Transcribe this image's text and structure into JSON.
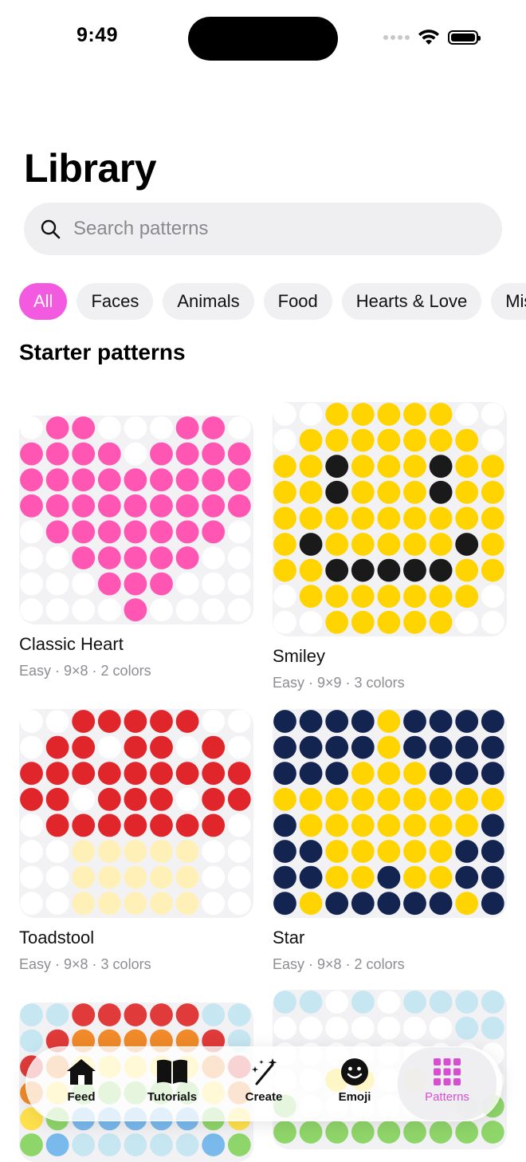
{
  "status": {
    "time": "9:49"
  },
  "page": {
    "title": "Library"
  },
  "search": {
    "placeholder": "Search patterns",
    "value": ""
  },
  "filters": [
    {
      "label": "All",
      "active": true
    },
    {
      "label": "Faces",
      "active": false
    },
    {
      "label": "Animals",
      "active": false
    },
    {
      "label": "Food",
      "active": false
    },
    {
      "label": "Hearts & Love",
      "active": false
    },
    {
      "label": "Misc",
      "active": false
    }
  ],
  "section": {
    "title": "Starter patterns"
  },
  "colors": {
    "accent": "#f25be0",
    "empty_dot": "#ffffff",
    "heart_pink": "#ff56b3",
    "yellow": "#ffd400",
    "black": "#1a1a1a",
    "red": "#e0262b",
    "cream": "#fff0b8",
    "navy": "#142451"
  },
  "patterns": [
    {
      "name": "Classic Heart",
      "meta": "Easy · 9×8 · 2 colors",
      "palette": {
        "0": "#ffffff",
        "1": "#ff56b3"
      },
      "grid": [
        "011000110",
        "111101111",
        "111111111",
        "111111111",
        "011111110",
        "001111100",
        "000111000",
        "000010000"
      ]
    },
    {
      "name": "Smiley",
      "meta": "Easy · 9×9 · 3 colors",
      "palette": {
        "0": "#ffffff",
        "1": "#ffd400",
        "2": "#1a1a1a"
      },
      "grid": [
        "001111100",
        "011111110",
        "112111211",
        "112111211",
        "111111111",
        "121111121",
        "112222211",
        "011111110",
        "001111100"
      ]
    },
    {
      "name": "Toadstool",
      "meta": "Easy · 9×8 · 3 colors",
      "palette": {
        "0": "#ffffff",
        "1": "#e0262b",
        "2": "#fff0b8"
      },
      "grid": [
        "001111100",
        "011011010",
        "111111111",
        "110111011",
        "011111110",
        "002222200",
        "002222200",
        "002222200"
      ]
    },
    {
      "name": "Star",
      "meta": "Easy · 9×8 · 2 colors",
      "palette": {
        "0": "#142451",
        "1": "#ffd400"
      },
      "grid": [
        "000010000",
        "000010000",
        "000111000",
        "111111111",
        "011111110",
        "001111100",
        "001101100",
        "010000010"
      ]
    },
    {
      "name": "",
      "meta": "",
      "palette": {
        "0": "#c6e6f2",
        "1": "#e03a3a",
        "2": "#f08a2a",
        "3": "#ffe14d",
        "4": "#8fd66a",
        "5": "#79b9ec"
      },
      "grid": [
        "001111100",
        "012222210",
        "123333321",
        "234444432",
        "345555543",
        "450000054"
      ]
    },
    {
      "name": "",
      "meta": "",
      "palette": {
        "0": "#c6e6f2",
        "1": "#ffffff",
        "2": "#ffd400",
        "3": "#8fd66a"
      },
      "grid": [
        "001010000",
        "111111100",
        "111111111",
        "112212111",
        "311111133",
        "333333333"
      ]
    }
  ],
  "tabs": [
    {
      "label": "Feed",
      "icon": "home-icon",
      "active": false
    },
    {
      "label": "Tutorials",
      "icon": "book-icon",
      "active": false
    },
    {
      "label": "Create",
      "icon": "magic-wand-icon",
      "active": false
    },
    {
      "label": "Emoji",
      "icon": "smiley-icon",
      "active": false
    },
    {
      "label": "Patterns",
      "icon": "grid-icon",
      "active": true
    }
  ]
}
